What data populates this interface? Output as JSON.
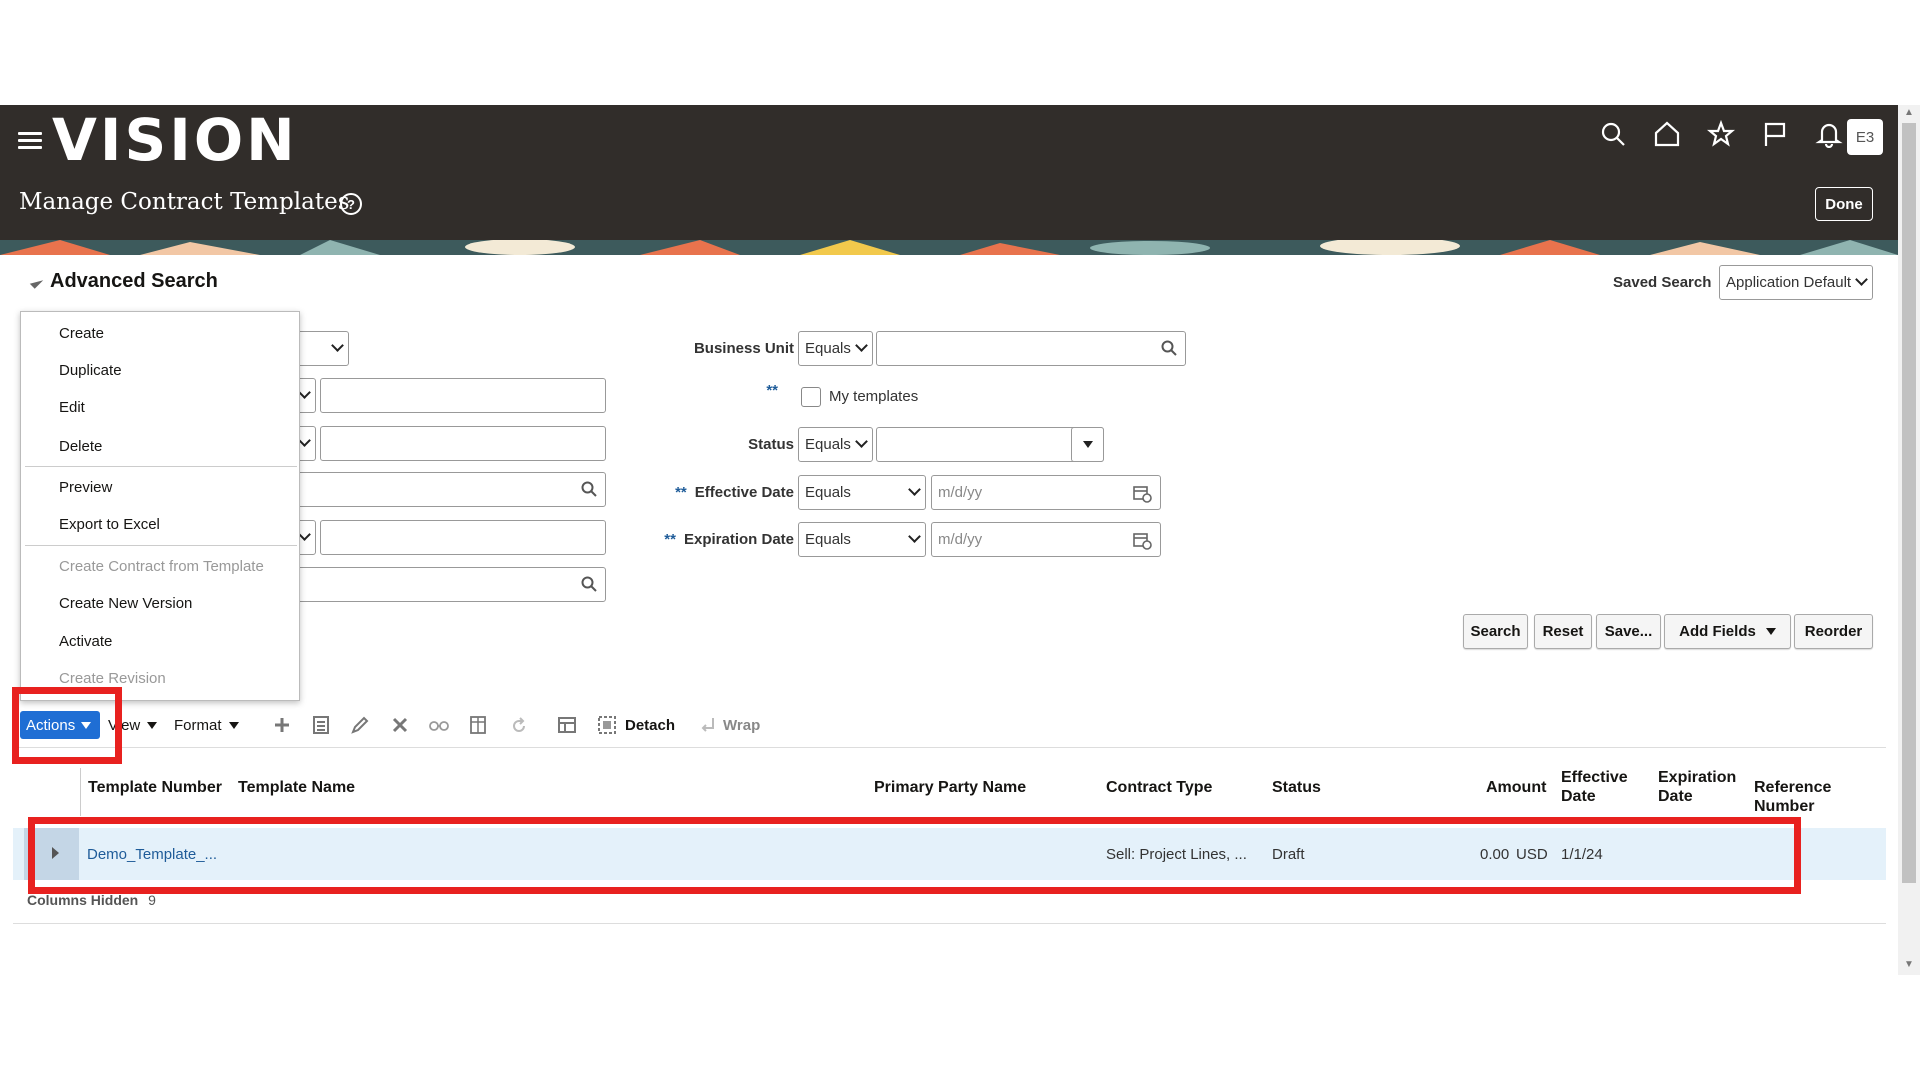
{
  "header": {
    "logo": "VISION",
    "title": "Manage Contract Templates",
    "help": "?",
    "done_label": "Done",
    "avatar_initials": "E3",
    "icons": [
      "search-icon",
      "home-icon",
      "star-icon",
      "flag-icon",
      "bell-icon"
    ]
  },
  "search": {
    "title": "Advanced Search",
    "saved_search_label": "Saved Search",
    "saved_search_value": "Application Default",
    "business_unit_label": "Business Unit",
    "business_unit_op": "Equals",
    "stars": "**",
    "my_templates_label": "My templates",
    "status_label": "Status",
    "status_op": "Equals",
    "effective_date_label": "Effective Date",
    "effective_date_op": "Equals",
    "effective_date_placeholder": "m/d/yy",
    "expiration_date_label": "Expiration Date",
    "expiration_date_op": "Equals",
    "expiration_date_placeholder": "m/d/yy",
    "buttons": {
      "search": "Search",
      "reset": "Reset",
      "save": "Save...",
      "add_fields": "Add Fields",
      "reorder": "Reorder"
    }
  },
  "actions_menu": {
    "items": [
      {
        "label": "Create",
        "enabled": true
      },
      {
        "label": "Duplicate",
        "enabled": true
      },
      {
        "label": "Edit",
        "enabled": true
      },
      {
        "label": "Delete",
        "enabled": true
      },
      {
        "label": "Preview",
        "enabled": true
      },
      {
        "label": "Export to Excel",
        "enabled": true
      },
      {
        "label": "Create Contract from Template",
        "enabled": false
      },
      {
        "label": "Create New Version",
        "enabled": true
      },
      {
        "label": "Activate",
        "enabled": true
      },
      {
        "label": "Create Revision",
        "enabled": false
      }
    ]
  },
  "toolbar": {
    "actions_label": "Actions",
    "view_label": "View",
    "format_label": "Format",
    "detach_label": "Detach",
    "wrap_label": "Wrap"
  },
  "table": {
    "headers": {
      "template_number": "Template Number",
      "template_name": "Template Name",
      "primary_party_name": "Primary Party Name",
      "contract_type": "Contract Type",
      "status": "Status",
      "amount": "Amount",
      "effective_date_1": "Effective",
      "effective_date_2": "Date",
      "expiration_date_1": "Expiration",
      "expiration_date_2": "Date",
      "reference_number_1": "Reference",
      "reference_number_2": "Number"
    },
    "rows": [
      {
        "template_number": "Demo_Template_...",
        "contract_type": "Sell: Project Lines, ...",
        "status": "Draft",
        "amount": "0.00",
        "currency": "USD",
        "effective_date": "1/1/24"
      }
    ],
    "columns_hidden_label": "Columns Hidden",
    "columns_hidden_count": "9"
  },
  "colors": {
    "header_bg": "#312d2a",
    "actions_bg": "#1f6ed4",
    "row_selected": "#e4f1fa",
    "highlight": "#e8211f",
    "link": "#1f5c99"
  }
}
